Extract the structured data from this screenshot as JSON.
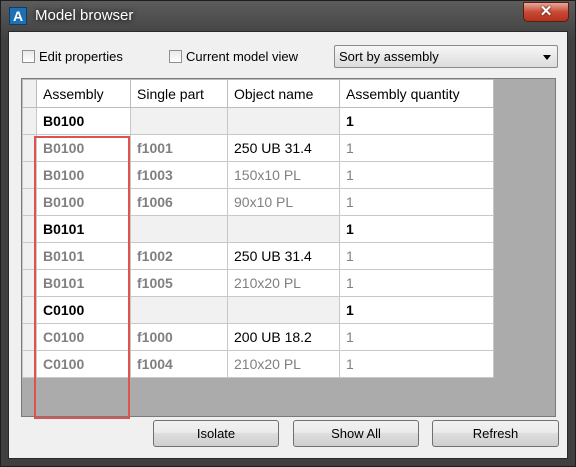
{
  "window": {
    "title": "Model browser",
    "close_label": "✕"
  },
  "toolbar": {
    "edit_properties": "Edit properties",
    "current_model_view": "Current model view",
    "sort_selected": "Sort by assembly"
  },
  "columns": [
    "Assembly",
    "Single part",
    "Object name",
    "Assembly quantity"
  ],
  "rows": [
    {
      "type": "group",
      "assembly": "B0100",
      "part": "",
      "object": "",
      "qty": "1"
    },
    {
      "type": "item",
      "assembly": "B0100",
      "part": "f1001",
      "object": "250 UB 31.4",
      "qty": "1"
    },
    {
      "type": "item",
      "assembly": "B0100",
      "part": "f1003",
      "object": "150x10 PL",
      "qty": "1"
    },
    {
      "type": "item",
      "assembly": "B0100",
      "part": "f1006",
      "object": "90x10 PL",
      "qty": "1"
    },
    {
      "type": "group",
      "assembly": "B0101",
      "part": "",
      "object": "",
      "qty": "1"
    },
    {
      "type": "item",
      "assembly": "B0101",
      "part": "f1002",
      "object": "250 UB 31.4",
      "qty": "1"
    },
    {
      "type": "item",
      "assembly": "B0101",
      "part": "f1005",
      "object": "210x20 PL",
      "qty": "1"
    },
    {
      "type": "group",
      "assembly": "C0100",
      "part": "",
      "object": "",
      "qty": "1"
    },
    {
      "type": "item",
      "assembly": "C0100",
      "part": "f1000",
      "object": "200 UB 18.2",
      "qty": "1"
    },
    {
      "type": "item",
      "assembly": "C0100",
      "part": "f1004",
      "object": "210x20 PL",
      "qty": "1"
    }
  ],
  "buttons": {
    "isolate": "Isolate",
    "show_all": "Show All",
    "refresh": "Refresh"
  },
  "colors": {
    "highlight": "#e0524e",
    "close": "#c84a35"
  }
}
